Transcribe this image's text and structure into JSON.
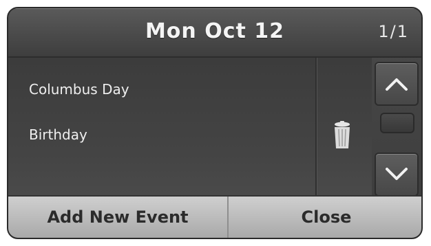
{
  "header": {
    "date": "Mon Oct 12",
    "page_indicator": "1/1"
  },
  "events": [
    {
      "label": "Columbus Day"
    },
    {
      "label": "Birthday",
      "icon": "trash-icon"
    }
  ],
  "scroll": {
    "up_icon": "chevron-up-icon",
    "down_icon": "chevron-down-icon"
  },
  "footer": {
    "add_label": "Add New Event",
    "close_label": "Close"
  }
}
